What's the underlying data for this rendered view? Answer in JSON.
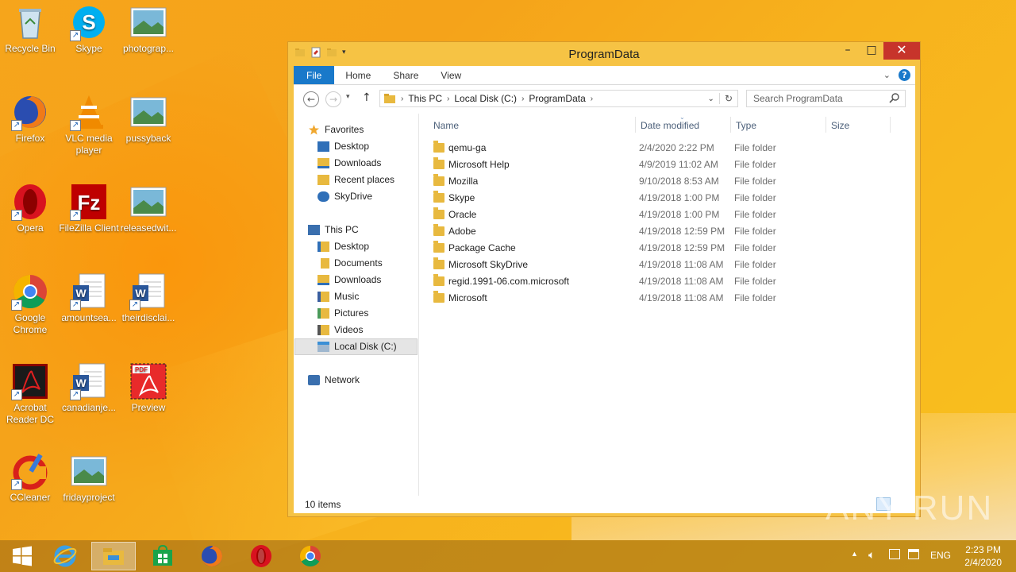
{
  "desktop": {
    "icons": [
      {
        "label": "Recycle Bin",
        "icon": "recycle-bin-icon"
      },
      {
        "label": "Skype",
        "icon": "skype-icon"
      },
      {
        "label": "photograp...",
        "icon": "image-file-icon"
      },
      {
        "label": "Firefox",
        "icon": "firefox-icon"
      },
      {
        "label": "VLC media player",
        "icon": "vlc-icon"
      },
      {
        "label": "pussyback",
        "icon": "image-file-icon"
      },
      {
        "label": "Opera",
        "icon": "opera-icon"
      },
      {
        "label": "FileZilla Client",
        "icon": "filezilla-icon"
      },
      {
        "label": "releasedwit...",
        "icon": "image-file-icon"
      },
      {
        "label": "Google Chrome",
        "icon": "chrome-icon"
      },
      {
        "label": "amountsea...",
        "icon": "word-doc-icon"
      },
      {
        "label": "theirdisclai...",
        "icon": "word-doc-icon"
      },
      {
        "label": "Acrobat Reader DC",
        "icon": "acrobat-icon"
      },
      {
        "label": "canadianje...",
        "icon": "word-doc-icon"
      },
      {
        "label": "Preview",
        "icon": "pdf-icon"
      },
      {
        "label": "CCleaner",
        "icon": "ccleaner-icon"
      },
      {
        "label": "fridayproject",
        "icon": "image-file-icon"
      }
    ]
  },
  "window": {
    "title": "ProgramData",
    "controls": {
      "minimize": "–",
      "maximize": "□",
      "close": "✕"
    },
    "ribbon_tabs": [
      "File",
      "Home",
      "Share",
      "View"
    ],
    "help": "?",
    "address": {
      "crumbs": [
        "This PC",
        "Local Disk (C:)",
        "ProgramData"
      ],
      "search_placeholder": "Search ProgramData"
    },
    "nav": {
      "favorites_label": "Favorites",
      "favorites": [
        "Desktop",
        "Downloads",
        "Recent places",
        "SkyDrive"
      ],
      "thispc_label": "This PC",
      "thispc": [
        "Desktop",
        "Documents",
        "Downloads",
        "Music",
        "Pictures",
        "Videos",
        "Local Disk (C:)"
      ],
      "network_label": "Network",
      "selected": "Local Disk (C:)"
    },
    "columns": {
      "name": "Name",
      "date": "Date modified",
      "type": "Type",
      "size": "Size"
    },
    "files": [
      {
        "name": "qemu-ga",
        "date": "2/4/2020 2:22 PM",
        "type": "File folder"
      },
      {
        "name": "Microsoft Help",
        "date": "4/9/2019 11:02 AM",
        "type": "File folder"
      },
      {
        "name": "Mozilla",
        "date": "9/10/2018 8:53 AM",
        "type": "File folder"
      },
      {
        "name": "Skype",
        "date": "4/19/2018 1:00 PM",
        "type": "File folder"
      },
      {
        "name": "Oracle",
        "date": "4/19/2018 1:00 PM",
        "type": "File folder"
      },
      {
        "name": "Adobe",
        "date": "4/19/2018 12:59 PM",
        "type": "File folder"
      },
      {
        "name": "Package Cache",
        "date": "4/19/2018 12:59 PM",
        "type": "File folder"
      },
      {
        "name": "Microsoft SkyDrive",
        "date": "4/19/2018 11:08 AM",
        "type": "File folder"
      },
      {
        "name": "regid.1991-06.com.microsoft",
        "date": "4/19/2018 11:08 AM",
        "type": "File folder"
      },
      {
        "name": "Microsoft",
        "date": "4/19/2018 11:08 AM",
        "type": "File folder"
      }
    ],
    "status": "10 items"
  },
  "taskbar": {
    "items": [
      "start-icon",
      "internet-explorer-icon",
      "file-explorer-icon",
      "store-icon",
      "firefox-icon",
      "opera-icon",
      "chrome-icon"
    ],
    "active": "file-explorer-icon",
    "lang": "ENG",
    "time": "2:23 PM",
    "date": "2/4/2020"
  },
  "watermark": "ANY RUN",
  "colors": {
    "accent": "#1979ca",
    "window_frame": "#f6c344",
    "close": "#c7342b"
  }
}
